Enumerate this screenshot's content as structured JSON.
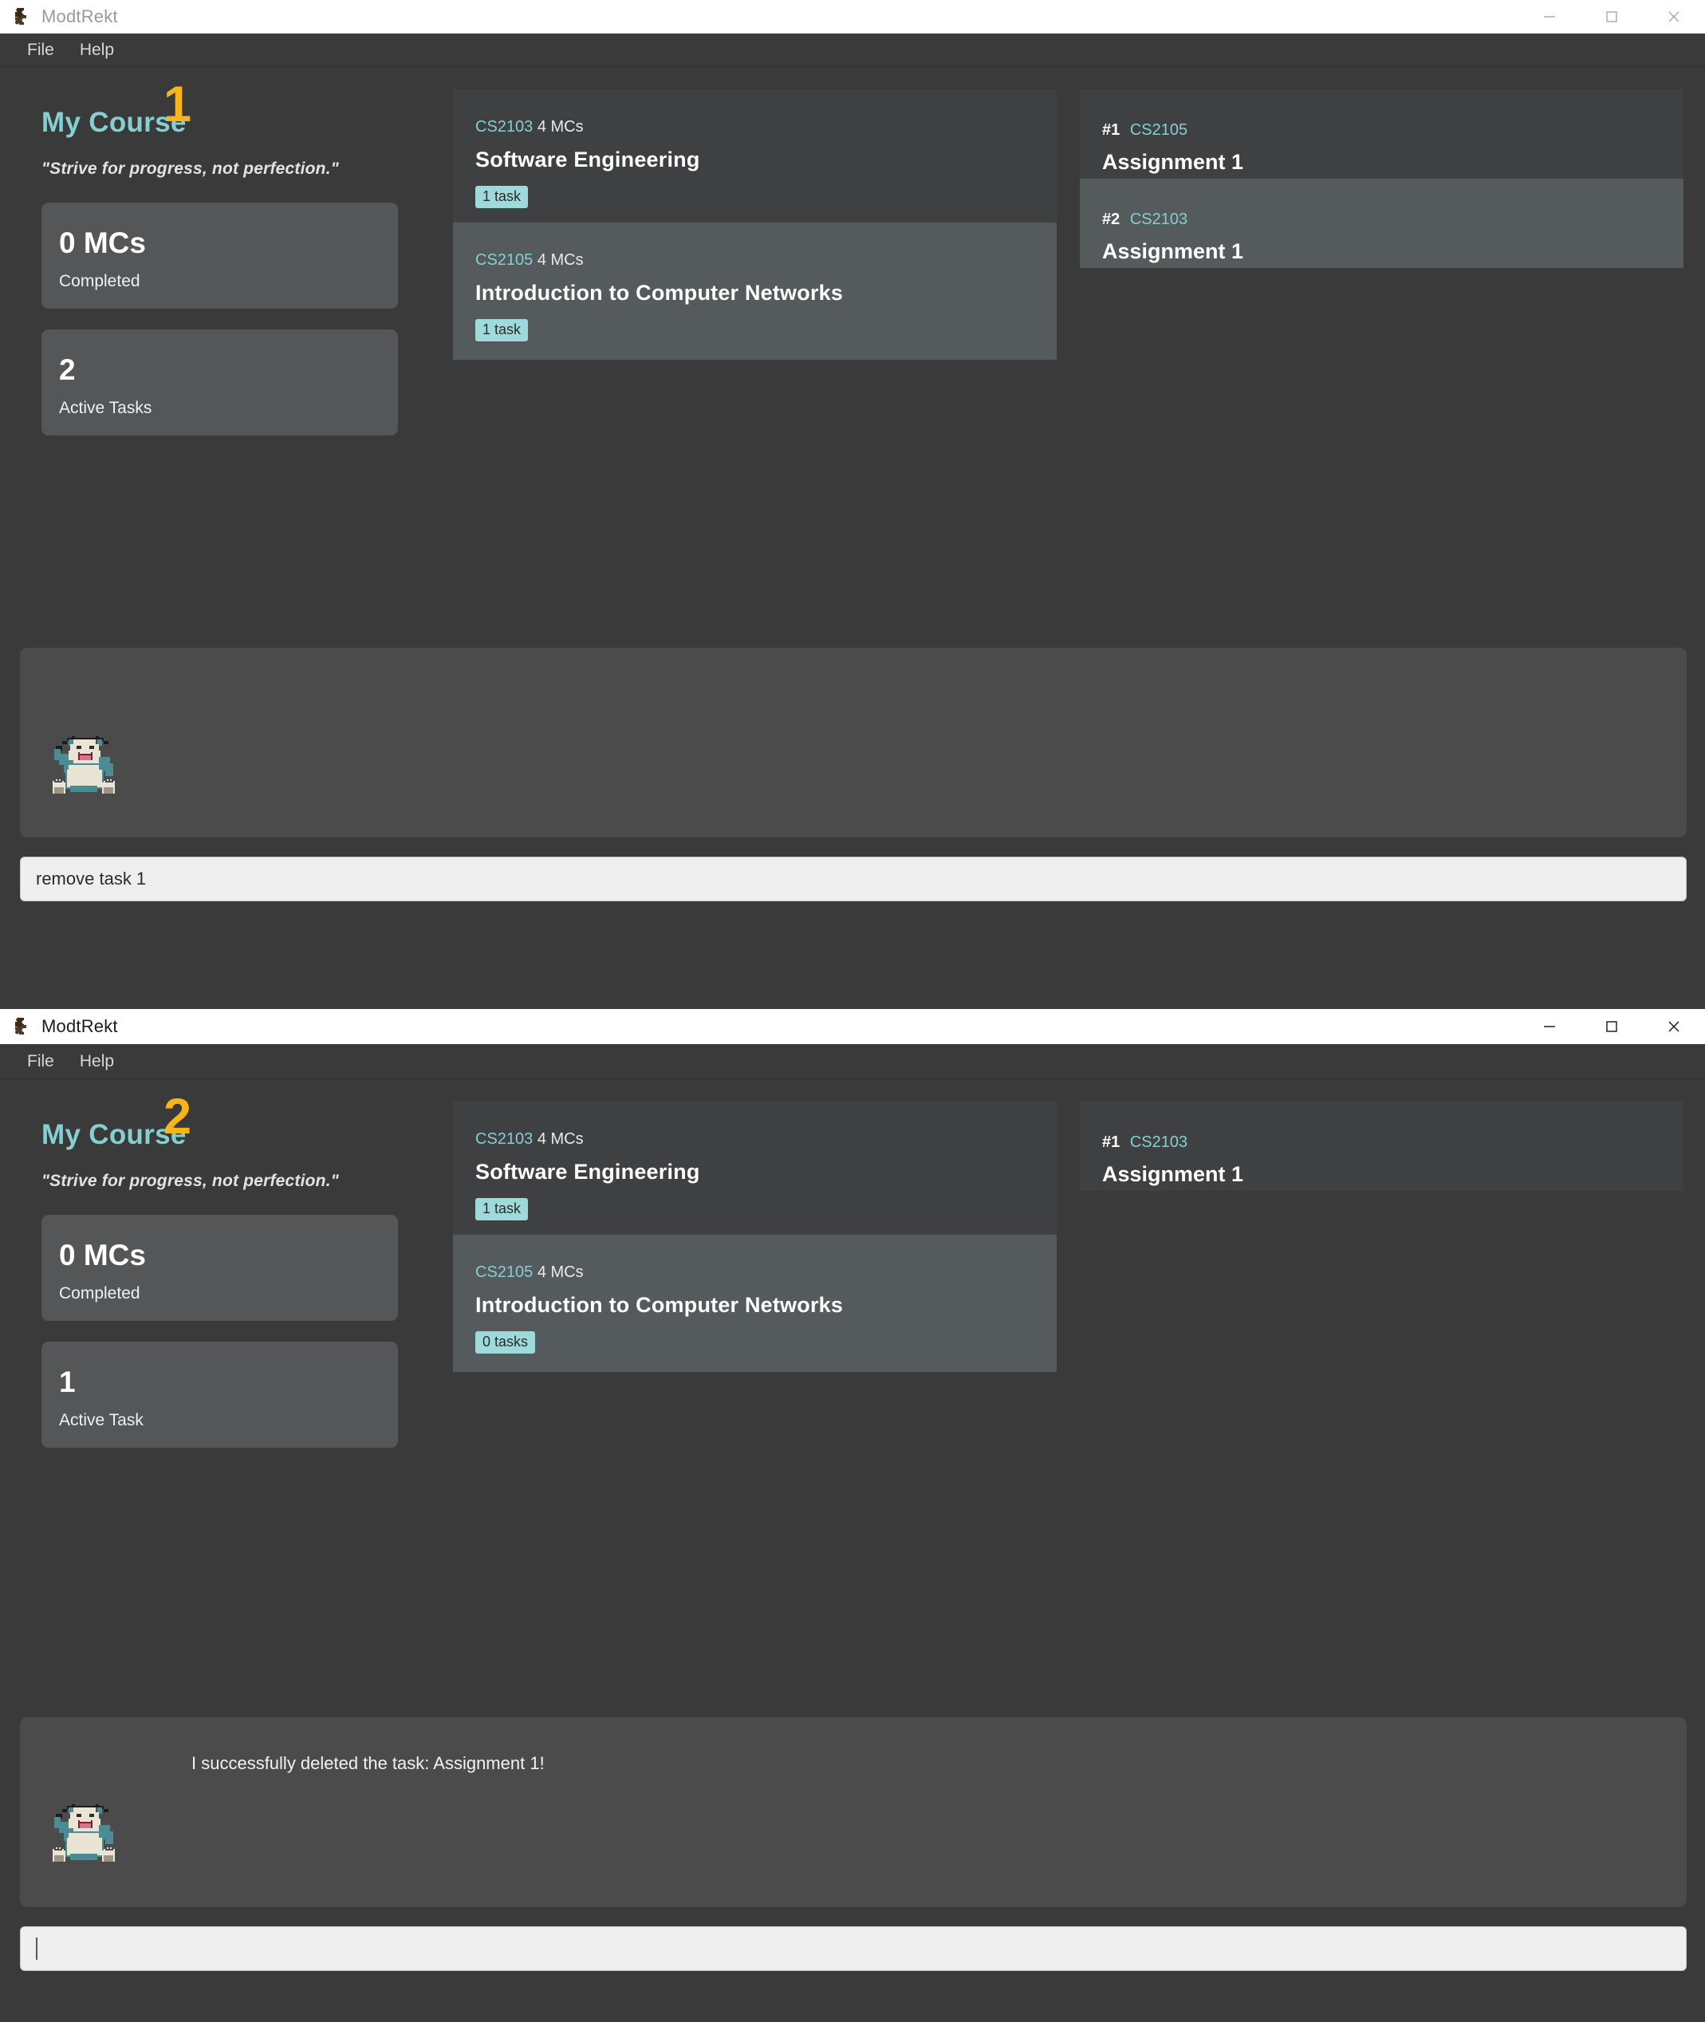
{
  "accent": {
    "teal": "#86cfd1",
    "badge_bg": "#9fdadb",
    "annotation_yellow": "#f9b41a",
    "window_bg": "#3a3a3a",
    "card_dark": "#3f4042",
    "card_light": "#555a5c",
    "stat_card": "#555657",
    "chat_panel": "#4b4b4b",
    "input_bg": "#eeeeee"
  },
  "windows": [
    {
      "annotation": "1",
      "titlebar": {
        "title": "ModtRekt",
        "icon": "puzzle-piece-icon",
        "active": false,
        "controls": [
          {
            "name": "minimize-button",
            "glyph": "minimize-icon"
          },
          {
            "name": "maximize-button",
            "glyph": "maximize-icon"
          },
          {
            "name": "close-button",
            "glyph": "close-icon"
          }
        ]
      },
      "menubar": [
        {
          "label": "File"
        },
        {
          "label": "Help"
        }
      ],
      "sidebar": {
        "title": "My Course",
        "quote": "\"Strive for progress, not perfection.\"",
        "stats": [
          {
            "value": "0 MCs",
            "label": "Completed"
          },
          {
            "value": "2",
            "label": "Active Tasks"
          }
        ]
      },
      "courses": [
        {
          "code": "CS2103",
          "mcs": "4 MCs",
          "name": "Software Engineering",
          "badge": "1 task",
          "selected": false
        },
        {
          "code": "CS2105",
          "mcs": "4 MCs",
          "name": "Introduction to Computer Networks",
          "badge": "1 task",
          "selected": true
        }
      ],
      "tasks": [
        {
          "rank": "#1",
          "code": "CS2105",
          "name": "Assignment 1",
          "selected": false
        },
        {
          "rank": "#2",
          "code": "CS2103",
          "name": "Assignment 1",
          "selected": true
        }
      ],
      "chat": {
        "message": "",
        "avatar": "snorlax-sprite"
      },
      "input": {
        "value": "remove task 1",
        "has_caret": false
      }
    },
    {
      "annotation": "2",
      "titlebar": {
        "title": "ModtRekt",
        "icon": "puzzle-piece-icon",
        "active": true,
        "controls": [
          {
            "name": "minimize-button",
            "glyph": "minimize-icon"
          },
          {
            "name": "maximize-button",
            "glyph": "maximize-icon"
          },
          {
            "name": "close-button",
            "glyph": "close-icon"
          }
        ]
      },
      "menubar": [
        {
          "label": "File"
        },
        {
          "label": "Help"
        }
      ],
      "sidebar": {
        "title": "My Course",
        "quote": "\"Strive for progress, not perfection.\"",
        "stats": [
          {
            "value": "0 MCs",
            "label": "Completed"
          },
          {
            "value": "1",
            "label": "Active Task"
          }
        ]
      },
      "courses": [
        {
          "code": "CS2103",
          "mcs": "4 MCs",
          "name": "Software Engineering",
          "badge": "1 task",
          "selected": false
        },
        {
          "code": "CS2105",
          "mcs": "4 MCs",
          "name": "Introduction to Computer Networks",
          "badge": "0 tasks",
          "selected": true
        }
      ],
      "tasks": [
        {
          "rank": "#1",
          "code": "CS2103",
          "name": "Assignment 1",
          "selected": false
        }
      ],
      "chat": {
        "message": "I successfully deleted the task: Assignment 1!",
        "avatar": "snorlax-sprite"
      },
      "input": {
        "value": "",
        "has_caret": true
      }
    }
  ]
}
